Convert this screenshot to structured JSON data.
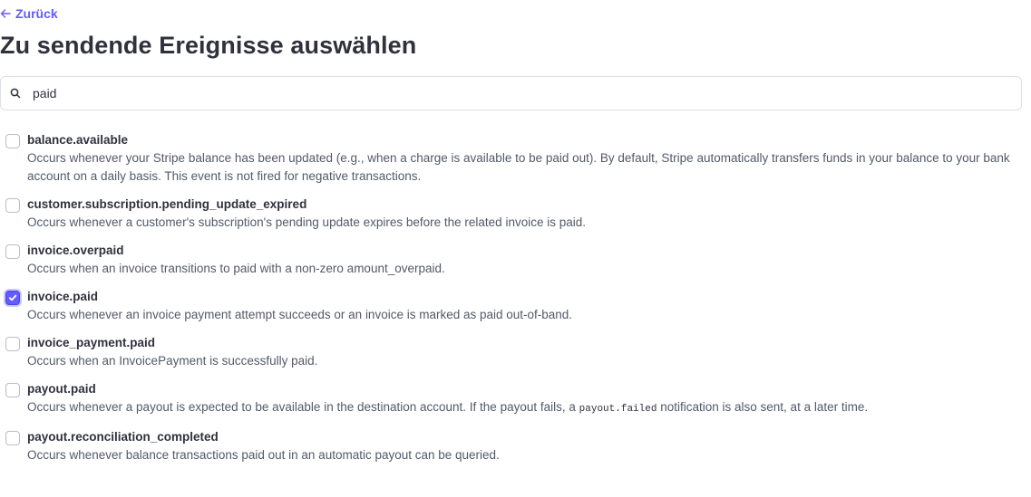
{
  "nav": {
    "back_label": "Zurück"
  },
  "header": {
    "title": "Zu sendende Ereignisse auswählen"
  },
  "search": {
    "value": "paid",
    "placeholder": ""
  },
  "colors": {
    "accent": "#635bff",
    "text_primary": "#30313d",
    "text_secondary": "#545969",
    "border": "#dcdfe5"
  },
  "events": [
    {
      "name": "balance.available",
      "checked": false,
      "desc": "Occurs whenever your Stripe balance has been updated (e.g., when a charge is available to be paid out). By default, Stripe automatically transfers funds in your balance to your bank account on a daily basis. This event is not fired for negative transactions."
    },
    {
      "name": "customer.subscription.pending_update_expired",
      "checked": false,
      "desc": "Occurs whenever a customer's subscription's pending update expires before the related invoice is paid."
    },
    {
      "name": "invoice.overpaid",
      "checked": false,
      "desc": "Occurs when an invoice transitions to paid with a non-zero amount_overpaid."
    },
    {
      "name": "invoice.paid",
      "checked": true,
      "desc": "Occurs whenever an invoice payment attempt succeeds or an invoice is marked as paid out-of-band."
    },
    {
      "name": "invoice_payment.paid",
      "checked": false,
      "desc": "Occurs when an InvoicePayment is successfully paid."
    },
    {
      "name": "payout.paid",
      "checked": false,
      "desc_before": "Occurs whenever a payout is expected to be available in the destination account. If the payout fails, a",
      "desc_code": "payout.failed",
      "desc_after": "notification is also sent, at a later time."
    },
    {
      "name": "payout.reconciliation_completed",
      "checked": false,
      "desc": "Occurs whenever balance transactions paid out in an automatic payout can be queried."
    }
  ]
}
